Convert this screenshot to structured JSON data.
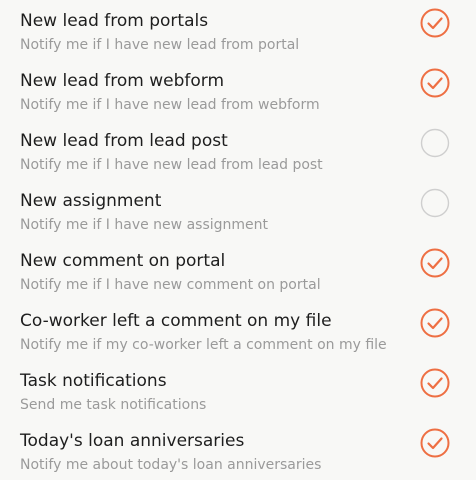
{
  "accent_color": "#ee6f43",
  "unchecked_color": "#cfcfcf",
  "settings": [
    {
      "title": "New lead from portals",
      "subtitle": "Notify me if I have new lead from portal",
      "checked": true
    },
    {
      "title": "New lead from webform",
      "subtitle": "Notify me if I have new lead from webform",
      "checked": true
    },
    {
      "title": "New lead from lead post",
      "subtitle": "Notify me if I have new lead from lead post",
      "checked": false
    },
    {
      "title": "New assignment",
      "subtitle": "Notify me if I have new assignment",
      "checked": false
    },
    {
      "title": "New comment on portal",
      "subtitle": "Notify me if I have new comment on portal",
      "checked": true
    },
    {
      "title": "Co-worker left a comment on my file",
      "subtitle": "Notify me if my co-worker left a comment on my file",
      "checked": true
    },
    {
      "title": "Task notifications",
      "subtitle": "Send me task notifications",
      "checked": true
    },
    {
      "title": "Today's loan anniversaries",
      "subtitle": "Notify me about today's loan anniversaries",
      "checked": true
    }
  ]
}
